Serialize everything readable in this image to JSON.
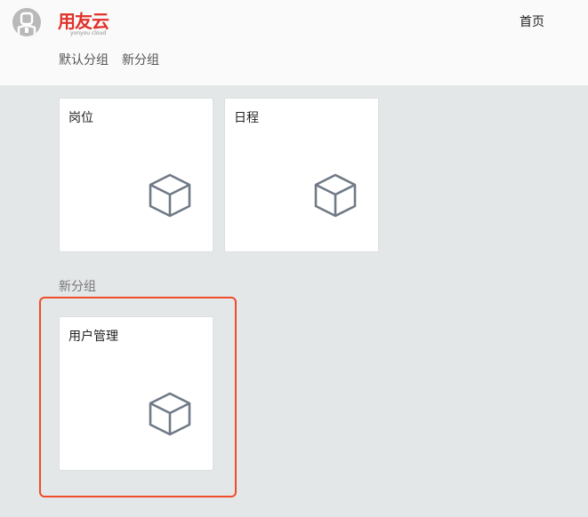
{
  "header": {
    "logo_text": "用友云",
    "logo_subtext": "yonyou cloud",
    "home_link": "首页"
  },
  "group_tabs": [
    {
      "label": "默认分组"
    },
    {
      "label": "新分组"
    }
  ],
  "groups": [
    {
      "name": "默认分组",
      "tiles": [
        {
          "label": "岗位",
          "icon": "cube-icon"
        },
        {
          "label": "日程",
          "icon": "cube-icon"
        }
      ]
    },
    {
      "name": "新分组",
      "tiles": [
        {
          "label": "用户管理",
          "icon": "cube-icon"
        }
      ]
    }
  ],
  "colors": {
    "brand": "#e0312a",
    "highlight": "#ef4d2a",
    "icon": "#6f7a86",
    "background": "#e4e7e8"
  }
}
